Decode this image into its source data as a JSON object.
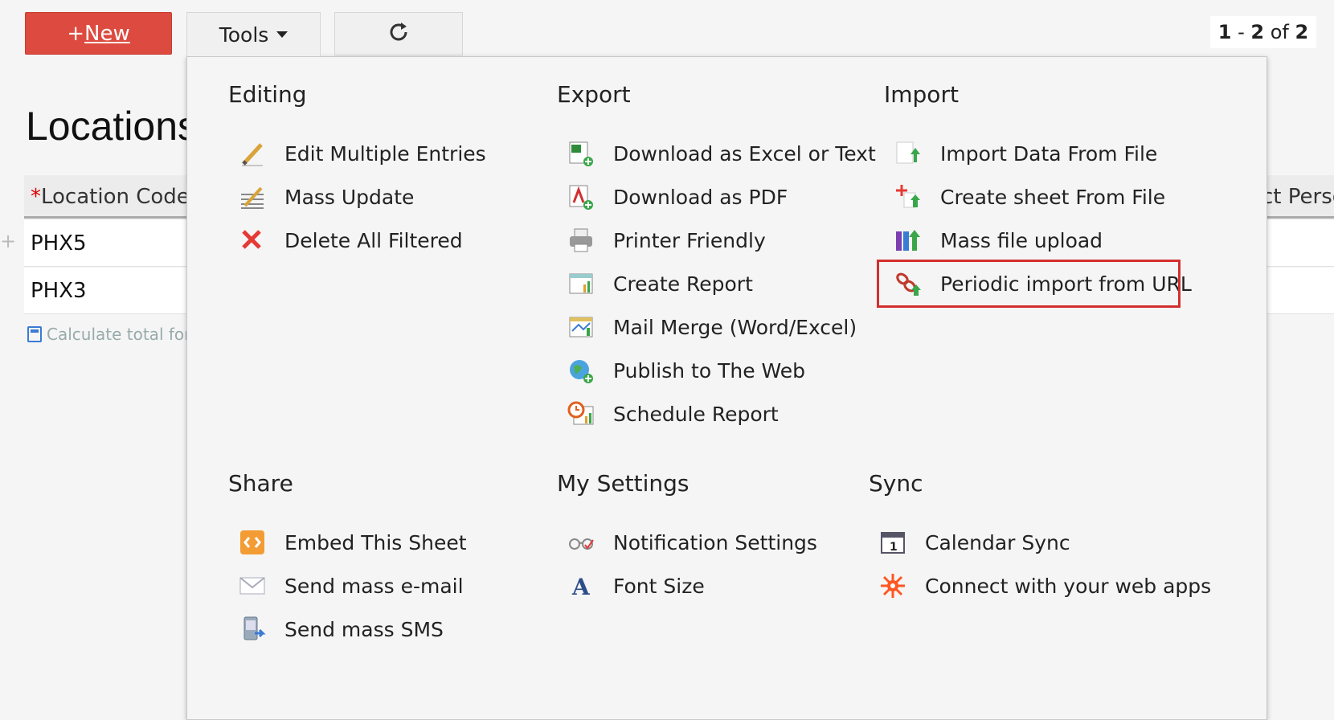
{
  "toolbar": {
    "new_prefix": "+",
    "new_label": "New",
    "tools_label": "Tools",
    "pager": {
      "start": "1",
      "sep": " - ",
      "end": "2",
      "of": " of ",
      "total": "2"
    }
  },
  "sheet": {
    "title": "Locations",
    "columns": [
      "Location Code",
      "ct Perso"
    ],
    "required_marker": "*",
    "rows": [
      "PHX5",
      "PHX3"
    ],
    "calc_label": "Calculate total for a"
  },
  "menu": {
    "editing": {
      "title": "Editing",
      "items": [
        "Edit Multiple Entries",
        "Mass Update",
        "Delete All Filtered"
      ]
    },
    "export": {
      "title": "Export",
      "items": [
        "Download as Excel or Text",
        "Download as PDF",
        "Printer Friendly",
        "Create Report",
        "Mail Merge (Word/Excel)",
        "Publish to The Web",
        "Schedule Report"
      ]
    },
    "import": {
      "title": "Import",
      "items": [
        "Import Data From File",
        "Create sheet From File",
        "Mass file upload",
        "Periodic import from URL"
      ]
    },
    "share": {
      "title": "Share",
      "items": [
        "Embed This Sheet",
        "Send mass e-mail",
        "Send mass SMS"
      ]
    },
    "settings": {
      "title": "My Settings",
      "items": [
        "Notification Settings",
        "Font Size"
      ]
    },
    "sync": {
      "title": "Sync",
      "items": [
        "Calendar Sync",
        "Connect with your web apps"
      ]
    }
  },
  "colors": {
    "new_button": "#dd4a3f",
    "highlight": "#d32f2f",
    "accent": "#3a7bd5"
  }
}
